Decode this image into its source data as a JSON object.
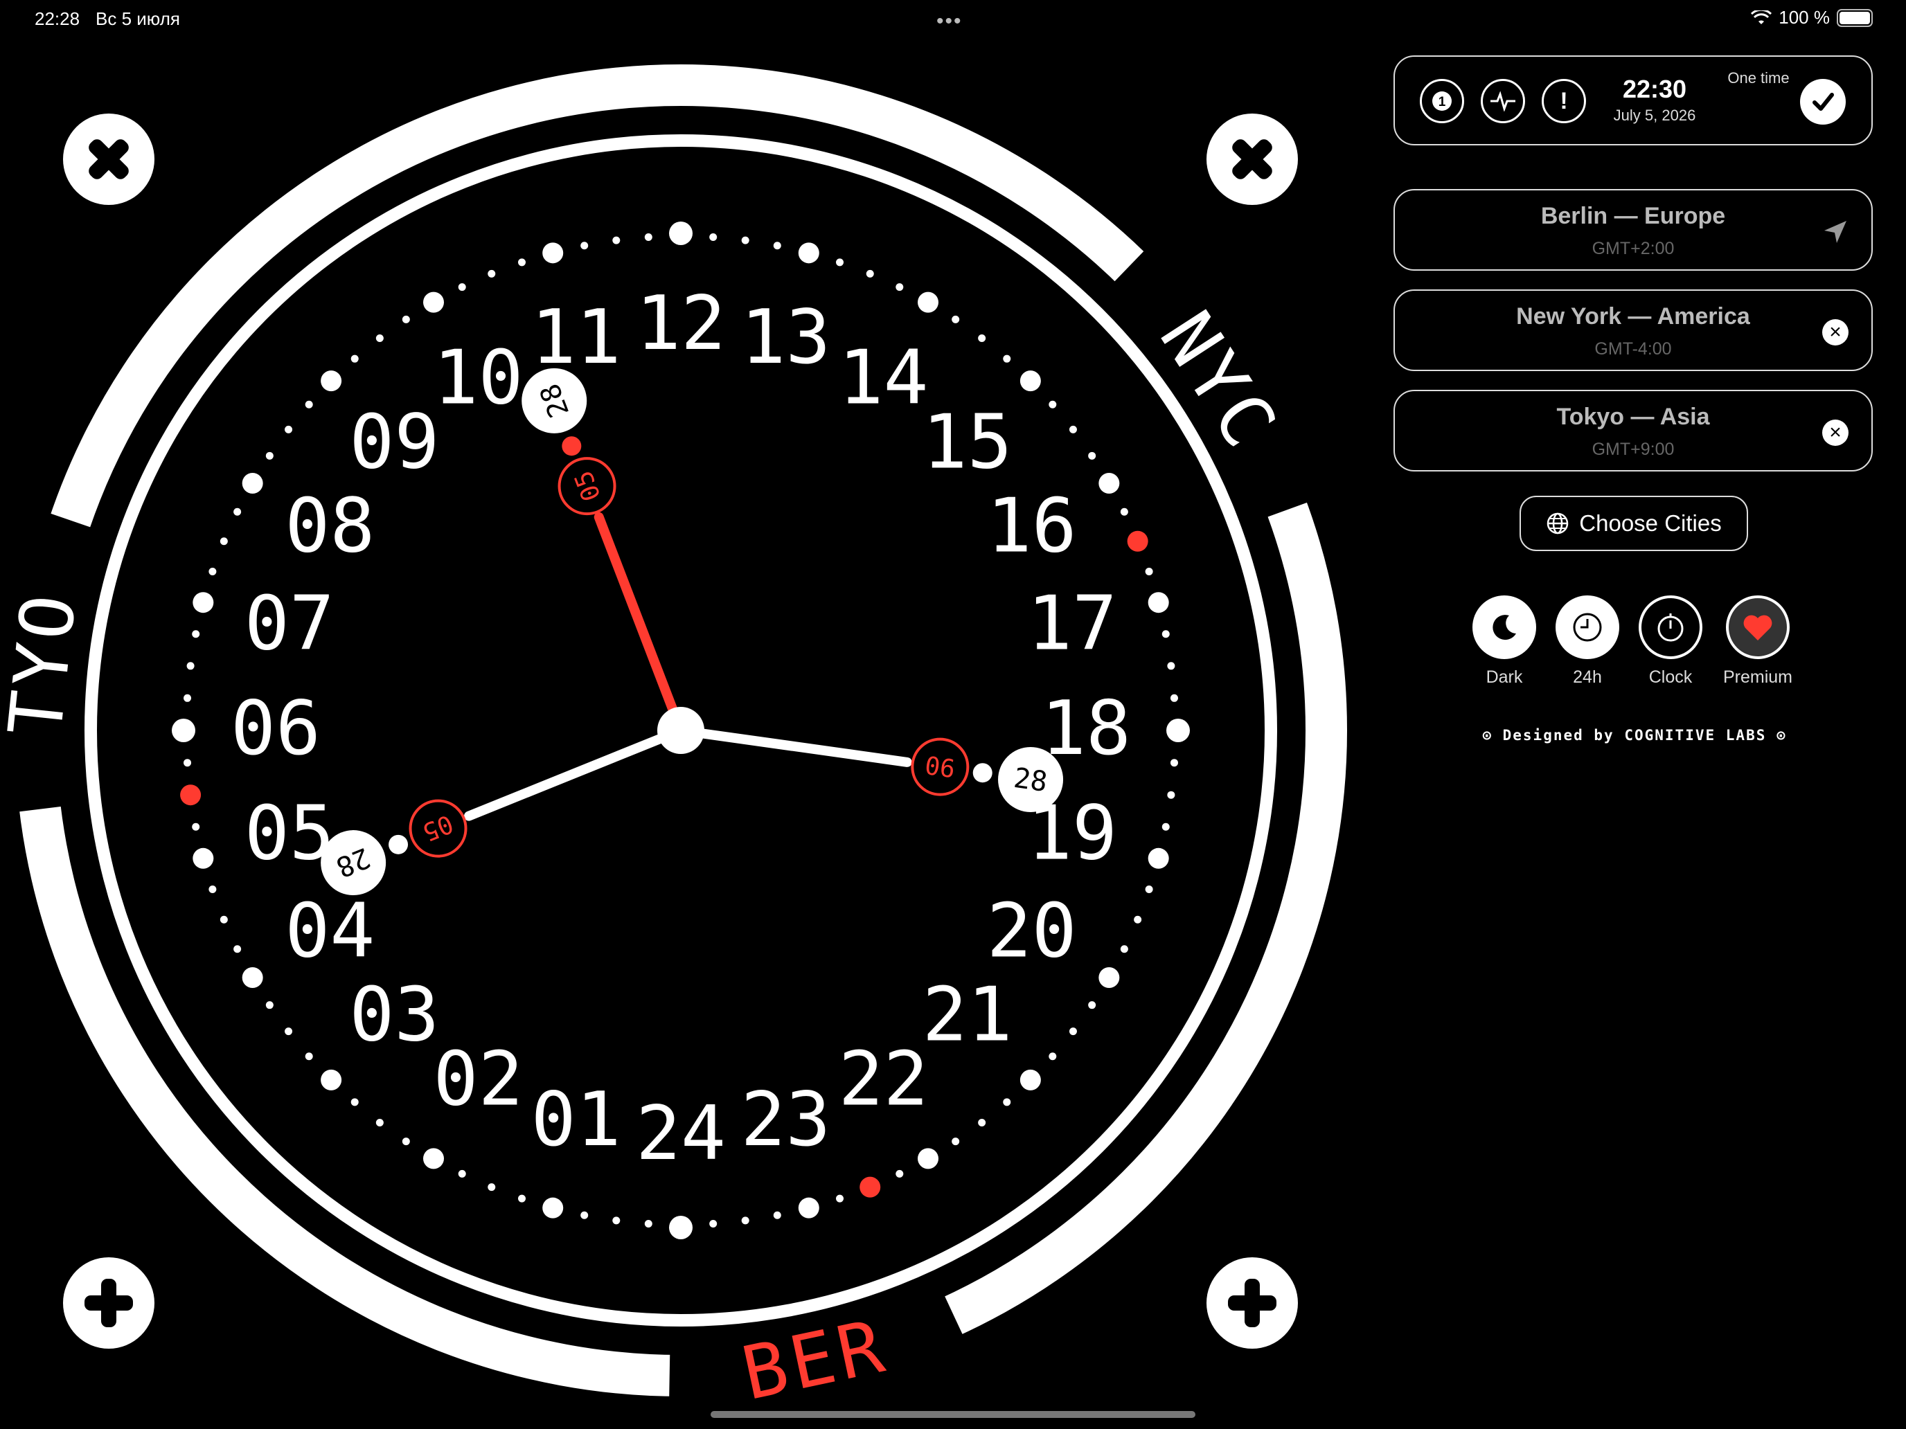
{
  "status_bar": {
    "time": "22:28",
    "date": "Вс 5 июля",
    "battery": "100 %"
  },
  "clock": {
    "hour_labels": [
      "24",
      "01",
      "02",
      "03",
      "04",
      "05",
      "06",
      "07",
      "08",
      "09",
      "10",
      "11",
      "12",
      "13",
      "14",
      "15",
      "16",
      "17",
      "18",
      "19",
      "20",
      "21",
      "22",
      "23"
    ],
    "city_labels": [
      {
        "text": "NYC",
        "color": "#ffffff"
      },
      {
        "text": "TYO",
        "color": "#ffffff"
      },
      {
        "text": "BER",
        "color": "#ff3b30"
      }
    ],
    "hands": [
      {
        "city": "Berlin",
        "hour_angle_deg": 248,
        "minute_label": "05",
        "day_label": "28",
        "color": "#ffffff"
      },
      {
        "city": "New York",
        "hour_angle_deg": 98,
        "minute_label": "06",
        "day_label": "28",
        "color": "#ffffff"
      },
      {
        "city": "Tokyo",
        "hour_angle_deg": 339,
        "minute_label": "05",
        "day_label": "28",
        "color": "#ff3b30"
      }
    ],
    "red_dots_at_hour": [
      22.5,
      16.5,
      5.5
    ],
    "accent_color": "#ff3b30"
  },
  "alarm_panel": {
    "icons": [
      "one-icon",
      "pulse-icon",
      "alert-icon"
    ],
    "time": "22:30",
    "date": "July 5, 2026",
    "mode": "One time"
  },
  "cities": [
    {
      "name": "Berlin — Europe",
      "tz": "GMT+2:00",
      "action": "location-icon"
    },
    {
      "name": "New York — America",
      "tz": "GMT-4:00",
      "action": "remove-icon"
    },
    {
      "name": "Tokyo — Asia",
      "tz": "GMT+9:00",
      "action": "remove-icon"
    }
  ],
  "choose_cities": {
    "label": "Choose Cities"
  },
  "modes": [
    {
      "label": "Dark",
      "icon": "moon-icon"
    },
    {
      "label": "24h",
      "icon": "clock-face-icon"
    },
    {
      "label": "Clock",
      "icon": "stopwatch-icon"
    },
    {
      "label": "Premium",
      "icon": "heart-icon"
    }
  ],
  "footer": {
    "designed_by": "⊙ Designed by COGNITIVE LABS ⊙"
  }
}
